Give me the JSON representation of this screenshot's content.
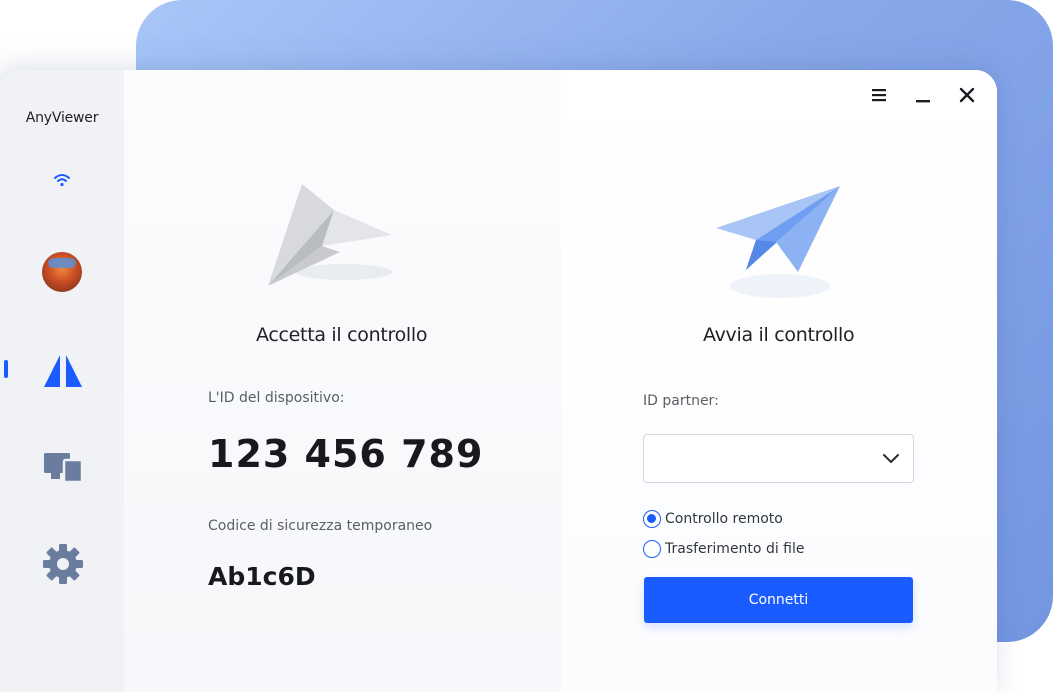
{
  "app": {
    "name": "AnyViewer"
  },
  "window_controls": {
    "menu_icon": "hamburger-icon",
    "minimize_icon": "minimize-icon",
    "close_icon": "close-icon"
  },
  "sidebar": {
    "items": [
      {
        "icon": "wifi-icon",
        "label": ""
      },
      {
        "icon": "avatar",
        "label": ""
      },
      {
        "icon": "connect-icon",
        "active": true
      },
      {
        "icon": "devices-icon"
      },
      {
        "icon": "gear-icon"
      }
    ]
  },
  "accept_panel": {
    "title": "Accetta il controllo",
    "device_id_label": "L'ID del dispositivo:",
    "device_id": "123 456 789",
    "security_code_label": "Codice di sicurezza temporaneo",
    "security_code": "Ab1c6D"
  },
  "start_panel": {
    "title": "Avvia il controllo",
    "partner_id_label": "ID partner:",
    "partner_id_value": "",
    "partner_id_placeholder": "",
    "modes": [
      {
        "label": "Controllo remoto",
        "selected": true
      },
      {
        "label": "Trasferimento di file",
        "selected": false
      }
    ],
    "connect_label": "Connetti"
  },
  "colors": {
    "accent": "#1a5cff",
    "sidebar_icon": "#6a7d9e",
    "backdrop": "#88a8ea"
  }
}
